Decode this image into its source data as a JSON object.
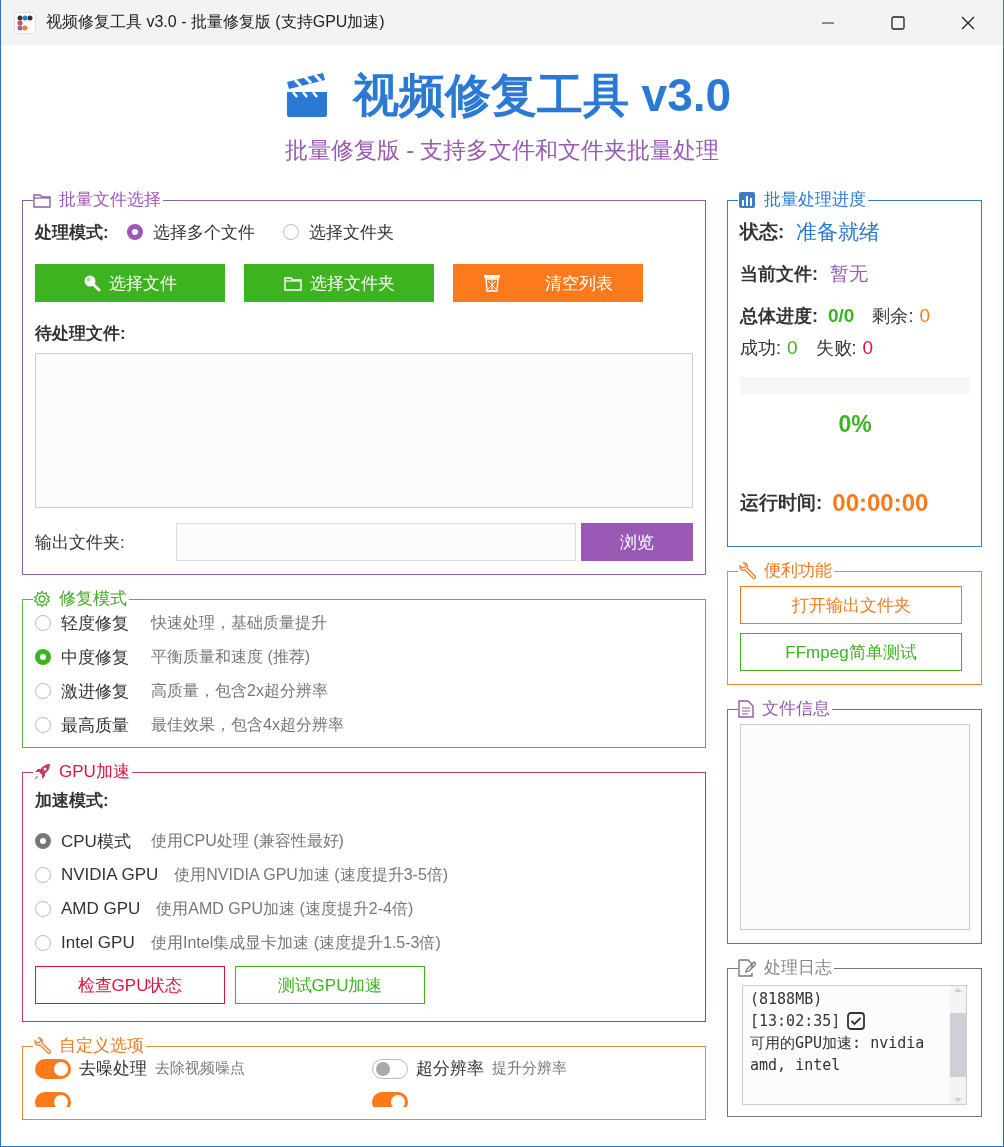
{
  "window": {
    "title": "视频修复工具 v3.0 - 批量修复版 (支持GPU加速)"
  },
  "header": {
    "title": "视频修复工具 v3.0",
    "subtitle": "批量修复版 - 支持多文件和文件夹批量处理"
  },
  "file_selection": {
    "title": "批量文件选择",
    "mode_label": "处理模式:",
    "modes": [
      {
        "label": "选择多个文件",
        "selected": true
      },
      {
        "label": "选择文件夹",
        "selected": false
      }
    ],
    "buttons": [
      {
        "label": "选择文件",
        "kind": "search"
      },
      {
        "label": "选择文件夹",
        "kind": "folder"
      },
      {
        "label": "清空列表",
        "kind": "clear"
      }
    ],
    "list_label": "待处理文件:",
    "output_label": "输出文件夹:",
    "browse_button": "浏览"
  },
  "repair_mode": {
    "title": "修复模式",
    "options": [
      {
        "label": "轻度修复",
        "description": "快速处理，基础质量提升",
        "selected": false
      },
      {
        "label": "中度修复",
        "description": "平衡质量和速度 (推荐)",
        "selected": true
      },
      {
        "label": "激进修复",
        "description": "高质量，包含2x超分辨率",
        "selected": false
      },
      {
        "label": "最高质量",
        "description": "最佳效果，包含4x超分辨率",
        "selected": false
      }
    ]
  },
  "gpu": {
    "title": "GPU加速",
    "mode_label": "加速模式:",
    "options": [
      {
        "label": "CPU模式",
        "description": "使用CPU处理 (兼容性最好)",
        "selected": true
      },
      {
        "label": "NVIDIA GPU",
        "description": "使用NVIDIA GPU加速 (速度提升3-5倍)",
        "selected": false
      },
      {
        "label": "AMD GPU",
        "description": "使用AMD GPU加速 (速度提升2-4倍)",
        "selected": false
      },
      {
        "label": "Intel GPU",
        "description": "使用Intel集成显卡加速 (速度提升1.5-3倍)",
        "selected": false
      }
    ],
    "buttons": [
      {
        "label": "检查GPU状态",
        "kind": "check"
      },
      {
        "label": "测试GPU加速",
        "kind": "test"
      }
    ]
  },
  "custom_options": {
    "title": "自定义选项",
    "toggles": [
      {
        "label": "去噪处理",
        "description": "去除视频噪点",
        "on": true
      },
      {
        "label": "超分辨率",
        "description": "提升分辨率",
        "on": false
      },
      {
        "on": true
      },
      {
        "on": true
      }
    ]
  },
  "progress": {
    "title": "批量处理进度",
    "status_label": "状态:",
    "status": "准备就绪",
    "current_label": "当前文件:",
    "current": "暂无",
    "overall_label": "总体进度:",
    "overall": "0/0",
    "remaining_label": "剩余:",
    "remaining": "0",
    "success_label": "成功:",
    "success": "0",
    "failed_label": "失败:",
    "failed": "0",
    "level": 0,
    "percent": "0%",
    "time_label": "运行时间:",
    "time": "00:00:00"
  },
  "utilities": {
    "title": "便利功能",
    "buttons": [
      {
        "label": "打开输出文件夹",
        "kind": "open"
      },
      {
        "label": "FFmpeg简单测试",
        "kind": "test"
      }
    ]
  },
  "file_info": {
    "title": "文件信息"
  },
  "log": {
    "title": "处理日志",
    "lines": [
      {
        "text": "(8188MB)"
      },
      {
        "text": "[13:02:35]",
        "kind": "check"
      },
      {
        "text": "可用的GPU加速: nvidia"
      },
      {
        "text": "amd, intel"
      }
    ]
  }
}
